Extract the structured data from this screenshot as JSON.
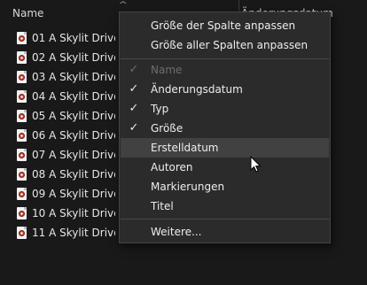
{
  "header": {
    "name_label": "Name",
    "date_label": "Änderungsdatum"
  },
  "files": [
    "01 A Skylit Drive - I",
    "02 A Skylit Drive - S",
    "03 A Skylit Drive - I",
    "04 A Skylit Drive - S",
    "05 A Skylit Drive - I",
    "06 A Skylit Drive - I",
    "07 A Skylit Drive - C",
    "08 A Skylit Drive - S",
    "09 A Skylit Drive - I",
    "10 A Skylit Drive - I",
    "11 A Skylit Drive - T"
  ],
  "menu": {
    "fit_column": "Größe der Spalte anpassen",
    "fit_all_columns": "Größe aller Spalten anpassen",
    "columns": [
      {
        "label": "Name",
        "checked": true,
        "disabled": true
      },
      {
        "label": "Änderungsdatum",
        "checked": true,
        "disabled": false
      },
      {
        "label": "Typ",
        "checked": true,
        "disabled": false
      },
      {
        "label": "Größe",
        "checked": true,
        "disabled": false
      },
      {
        "label": "Erstelldatum",
        "checked": false,
        "disabled": false,
        "hover": true
      },
      {
        "label": "Autoren",
        "checked": false,
        "disabled": false
      },
      {
        "label": "Markierungen",
        "checked": false,
        "disabled": false
      },
      {
        "label": "Titel",
        "checked": false,
        "disabled": false
      }
    ],
    "more": "Weitere...",
    "check_glyph": "✓"
  },
  "colors": {
    "background": "#191919",
    "menu_background": "#2b2b2b",
    "menu_hover": "#414141",
    "text": "#e6e6e6",
    "disabled_text": "#6d6d6d"
  }
}
